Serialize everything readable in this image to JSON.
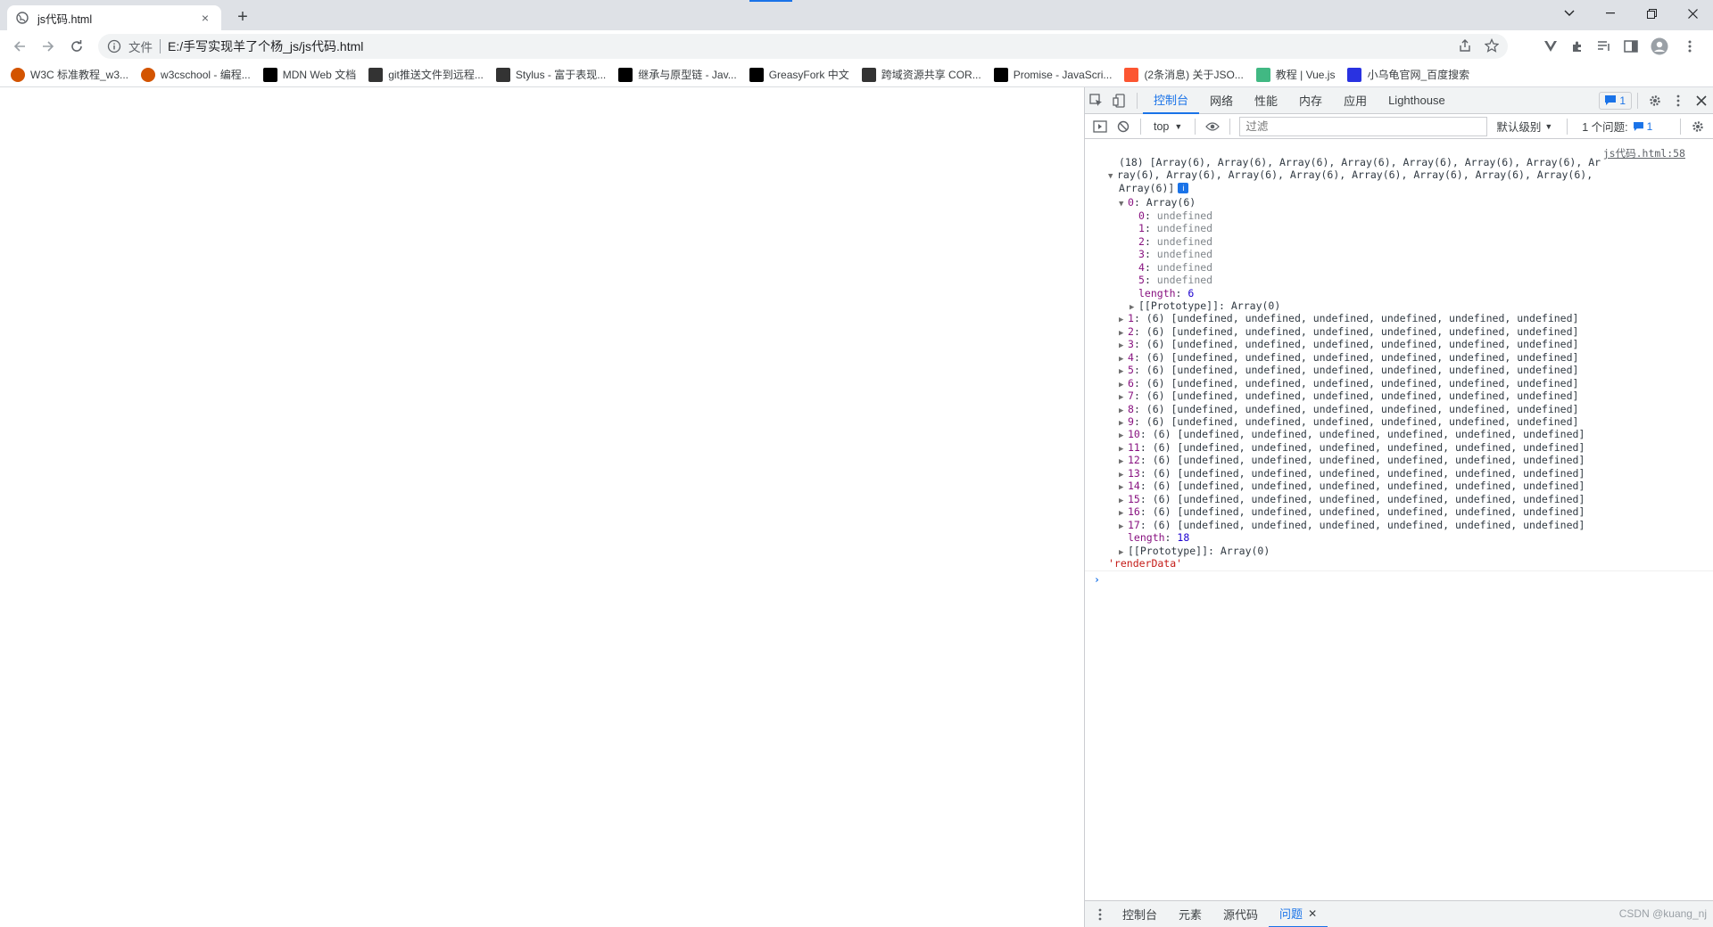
{
  "browser": {
    "tab_title": "js代码.html",
    "tab_close": "×",
    "new_tab": "+",
    "address": {
      "scheme_label": "文件",
      "url": "E:/手写实现羊了个杨_js/js代码.html"
    },
    "bookmarks": [
      {
        "label": "W3C 标准教程_w3...",
        "icon": "w3c-icon",
        "color": "#d35400"
      },
      {
        "label": "w3cschool - 编程...",
        "icon": "w3cschool-icon",
        "color": "#d35400"
      },
      {
        "label": "MDN Web 文档",
        "icon": "mdn-icon",
        "color": "#000000"
      },
      {
        "label": "git推送文件到远程...",
        "icon": "git-icon",
        "color": "#333333"
      },
      {
        "label": "Stylus - 富于表现...",
        "icon": "stylus-icon",
        "color": "#333333"
      },
      {
        "label": "继承与原型链 - Jav...",
        "icon": "mdn-icon",
        "color": "#000000"
      },
      {
        "label": "GreasyFork 中文",
        "icon": "greasyfork-icon",
        "color": "#000000"
      },
      {
        "label": "跨域资源共享 COR...",
        "icon": "stylus-icon",
        "color": "#333333"
      },
      {
        "label": "Promise - JavaScri...",
        "icon": "mdn-icon",
        "color": "#000000"
      },
      {
        "label": "(2条消息) 关于JSO...",
        "icon": "csdn-icon",
        "color": "#fc5531"
      },
      {
        "label": "教程 | Vue.js",
        "icon": "vue-icon",
        "color": "#41b883"
      },
      {
        "label": "小乌龟官网_百度搜索",
        "icon": "baidu-icon",
        "color": "#2932e1"
      }
    ]
  },
  "devtools": {
    "tabs": [
      "控制台",
      "网络",
      "性能",
      "内存",
      "应用",
      "Lighthouse"
    ],
    "active_tab": "控制台",
    "issues_count": "1",
    "console_toolbar": {
      "context": "top",
      "filter_placeholder": "过滤",
      "level": "默认级别",
      "issues_label": "1 个问题:",
      "issues_count": "1"
    },
    "source_link": "js代码.html:58",
    "log": {
      "header_line1": "(18) [Array(6), Array(6), Array(6), Array(6), Array(6), Array(6), Array(6), Ar",
      "header_line2": "ray(6), Array(6), Array(6), Array(6), Array(6), Array(6), Array(6), Array(6),",
      "header_line3": "Array(6)]",
      "expanded_key": "0",
      "expanded_value": "Array(6)",
      "inner_items": [
        {
          "key": "0",
          "value": "undefined"
        },
        {
          "key": "1",
          "value": "undefined"
        },
        {
          "key": "2",
          "value": "undefined"
        },
        {
          "key": "3",
          "value": "undefined"
        },
        {
          "key": "4",
          "value": "undefined"
        },
        {
          "key": "5",
          "value": "undefined"
        }
      ],
      "inner_length": "6",
      "prototype_label": "[[Prototype]]",
      "prototype_value": "Array(0)",
      "collapsed_rows": [
        {
          "key": "1",
          "value": "(6) [undefined, undefined, undefined, undefined, undefined, undefined]"
        },
        {
          "key": "2",
          "value": "(6) [undefined, undefined, undefined, undefined, undefined, undefined]"
        },
        {
          "key": "3",
          "value": "(6) [undefined, undefined, undefined, undefined, undefined, undefined]"
        },
        {
          "key": "4",
          "value": "(6) [undefined, undefined, undefined, undefined, undefined, undefined]"
        },
        {
          "key": "5",
          "value": "(6) [undefined, undefined, undefined, undefined, undefined, undefined]"
        },
        {
          "key": "6",
          "value": "(6) [undefined, undefined, undefined, undefined, undefined, undefined]"
        },
        {
          "key": "7",
          "value": "(6) [undefined, undefined, undefined, undefined, undefined, undefined]"
        },
        {
          "key": "8",
          "value": "(6) [undefined, undefined, undefined, undefined, undefined, undefined]"
        },
        {
          "key": "9",
          "value": "(6) [undefined, undefined, undefined, undefined, undefined, undefined]"
        },
        {
          "key": "10",
          "value": "(6) [undefined, undefined, undefined, undefined, undefined, undefined]"
        },
        {
          "key": "11",
          "value": "(6) [undefined, undefined, undefined, undefined, undefined, undefined]"
        },
        {
          "key": "12",
          "value": "(6) [undefined, undefined, undefined, undefined, undefined, undefined]"
        },
        {
          "key": "13",
          "value": "(6) [undefined, undefined, undefined, undefined, undefined, undefined]"
        },
        {
          "key": "14",
          "value": "(6) [undefined, undefined, undefined, undefined, undefined, undefined]"
        },
        {
          "key": "15",
          "value": "(6) [undefined, undefined, undefined, undefined, undefined, undefined]"
        },
        {
          "key": "16",
          "value": "(6) [undefined, undefined, undefined, undefined, undefined, undefined]"
        },
        {
          "key": "17",
          "value": "(6) [undefined, undefined, undefined, undefined, undefined, undefined]"
        }
      ],
      "outer_length": "18",
      "string_log": "'renderData'",
      "prompt": "›"
    },
    "drawer_tabs": [
      "控制台",
      "元素",
      "源代码",
      "问题"
    ],
    "drawer_active": "问题"
  },
  "watermark": "CSDN @kuang_nj"
}
